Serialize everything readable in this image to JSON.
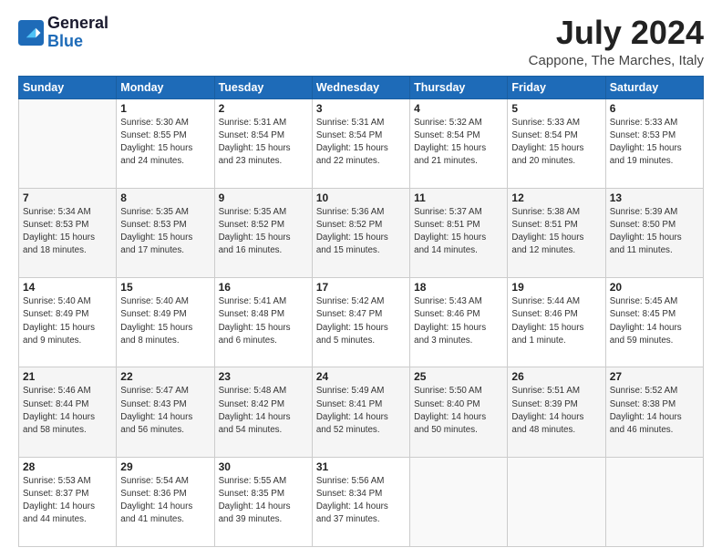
{
  "header": {
    "logo_line1": "General",
    "logo_line2": "Blue",
    "month_title": "July 2024",
    "location": "Cappone, The Marches, Italy"
  },
  "days_of_week": [
    "Sunday",
    "Monday",
    "Tuesday",
    "Wednesday",
    "Thursday",
    "Friday",
    "Saturday"
  ],
  "weeks": [
    [
      {
        "num": "",
        "info": ""
      },
      {
        "num": "1",
        "info": "Sunrise: 5:30 AM\nSunset: 8:55 PM\nDaylight: 15 hours\nand 24 minutes."
      },
      {
        "num": "2",
        "info": "Sunrise: 5:31 AM\nSunset: 8:54 PM\nDaylight: 15 hours\nand 23 minutes."
      },
      {
        "num": "3",
        "info": "Sunrise: 5:31 AM\nSunset: 8:54 PM\nDaylight: 15 hours\nand 22 minutes."
      },
      {
        "num": "4",
        "info": "Sunrise: 5:32 AM\nSunset: 8:54 PM\nDaylight: 15 hours\nand 21 minutes."
      },
      {
        "num": "5",
        "info": "Sunrise: 5:33 AM\nSunset: 8:54 PM\nDaylight: 15 hours\nand 20 minutes."
      },
      {
        "num": "6",
        "info": "Sunrise: 5:33 AM\nSunset: 8:53 PM\nDaylight: 15 hours\nand 19 minutes."
      }
    ],
    [
      {
        "num": "7",
        "info": "Sunrise: 5:34 AM\nSunset: 8:53 PM\nDaylight: 15 hours\nand 18 minutes."
      },
      {
        "num": "8",
        "info": "Sunrise: 5:35 AM\nSunset: 8:53 PM\nDaylight: 15 hours\nand 17 minutes."
      },
      {
        "num": "9",
        "info": "Sunrise: 5:35 AM\nSunset: 8:52 PM\nDaylight: 15 hours\nand 16 minutes."
      },
      {
        "num": "10",
        "info": "Sunrise: 5:36 AM\nSunset: 8:52 PM\nDaylight: 15 hours\nand 15 minutes."
      },
      {
        "num": "11",
        "info": "Sunrise: 5:37 AM\nSunset: 8:51 PM\nDaylight: 15 hours\nand 14 minutes."
      },
      {
        "num": "12",
        "info": "Sunrise: 5:38 AM\nSunset: 8:51 PM\nDaylight: 15 hours\nand 12 minutes."
      },
      {
        "num": "13",
        "info": "Sunrise: 5:39 AM\nSunset: 8:50 PM\nDaylight: 15 hours\nand 11 minutes."
      }
    ],
    [
      {
        "num": "14",
        "info": "Sunrise: 5:40 AM\nSunset: 8:49 PM\nDaylight: 15 hours\nand 9 minutes."
      },
      {
        "num": "15",
        "info": "Sunrise: 5:40 AM\nSunset: 8:49 PM\nDaylight: 15 hours\nand 8 minutes."
      },
      {
        "num": "16",
        "info": "Sunrise: 5:41 AM\nSunset: 8:48 PM\nDaylight: 15 hours\nand 6 minutes."
      },
      {
        "num": "17",
        "info": "Sunrise: 5:42 AM\nSunset: 8:47 PM\nDaylight: 15 hours\nand 5 minutes."
      },
      {
        "num": "18",
        "info": "Sunrise: 5:43 AM\nSunset: 8:46 PM\nDaylight: 15 hours\nand 3 minutes."
      },
      {
        "num": "19",
        "info": "Sunrise: 5:44 AM\nSunset: 8:46 PM\nDaylight: 15 hours\nand 1 minute."
      },
      {
        "num": "20",
        "info": "Sunrise: 5:45 AM\nSunset: 8:45 PM\nDaylight: 14 hours\nand 59 minutes."
      }
    ],
    [
      {
        "num": "21",
        "info": "Sunrise: 5:46 AM\nSunset: 8:44 PM\nDaylight: 14 hours\nand 58 minutes."
      },
      {
        "num": "22",
        "info": "Sunrise: 5:47 AM\nSunset: 8:43 PM\nDaylight: 14 hours\nand 56 minutes."
      },
      {
        "num": "23",
        "info": "Sunrise: 5:48 AM\nSunset: 8:42 PM\nDaylight: 14 hours\nand 54 minutes."
      },
      {
        "num": "24",
        "info": "Sunrise: 5:49 AM\nSunset: 8:41 PM\nDaylight: 14 hours\nand 52 minutes."
      },
      {
        "num": "25",
        "info": "Sunrise: 5:50 AM\nSunset: 8:40 PM\nDaylight: 14 hours\nand 50 minutes."
      },
      {
        "num": "26",
        "info": "Sunrise: 5:51 AM\nSunset: 8:39 PM\nDaylight: 14 hours\nand 48 minutes."
      },
      {
        "num": "27",
        "info": "Sunrise: 5:52 AM\nSunset: 8:38 PM\nDaylight: 14 hours\nand 46 minutes."
      }
    ],
    [
      {
        "num": "28",
        "info": "Sunrise: 5:53 AM\nSunset: 8:37 PM\nDaylight: 14 hours\nand 44 minutes."
      },
      {
        "num": "29",
        "info": "Sunrise: 5:54 AM\nSunset: 8:36 PM\nDaylight: 14 hours\nand 41 minutes."
      },
      {
        "num": "30",
        "info": "Sunrise: 5:55 AM\nSunset: 8:35 PM\nDaylight: 14 hours\nand 39 minutes."
      },
      {
        "num": "31",
        "info": "Sunrise: 5:56 AM\nSunset: 8:34 PM\nDaylight: 14 hours\nand 37 minutes."
      },
      {
        "num": "",
        "info": ""
      },
      {
        "num": "",
        "info": ""
      },
      {
        "num": "",
        "info": ""
      }
    ]
  ]
}
